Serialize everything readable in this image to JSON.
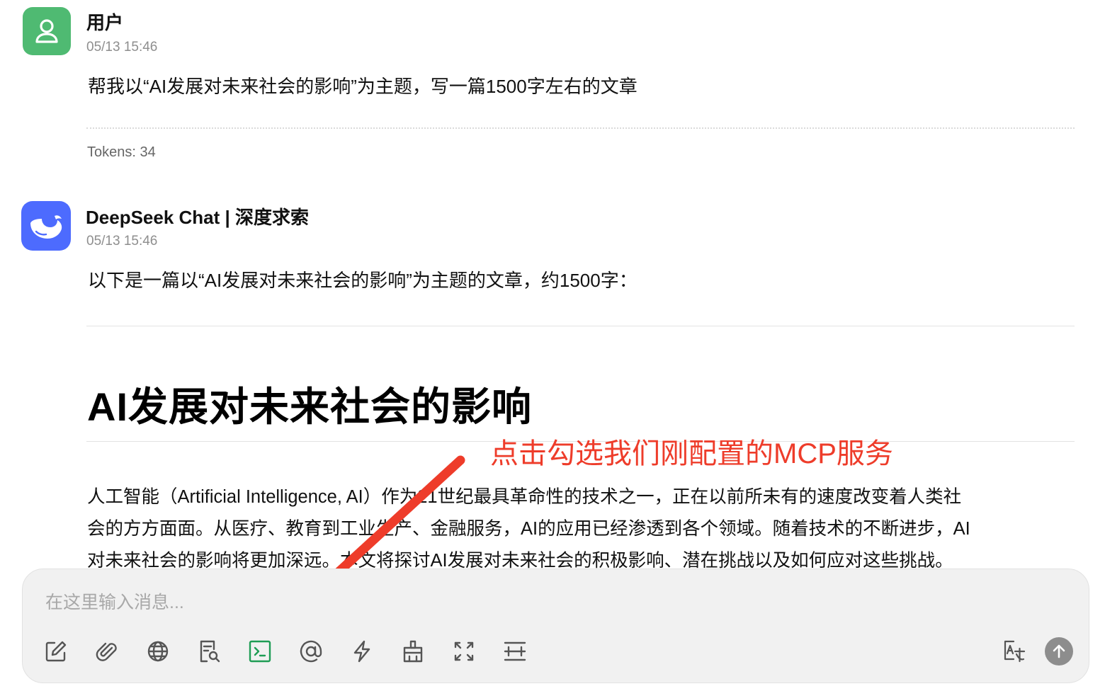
{
  "user_message": {
    "author": "用户",
    "time": "05/13 15:46",
    "text": "帮我以“AI发展对未来社会的影响”为主题，写一篇1500字左右的文章",
    "tokens": "Tokens: 34",
    "avatar_icon": "user-icon"
  },
  "assistant_message": {
    "author": "DeepSeek Chat | 深度求索",
    "time": "05/13 15:46",
    "intro": "以下是一篇以“AI发展对未来社会的影响”为主题的文章，约1500字：",
    "heading": "AI发展对未来社会的影响",
    "paragraph_lines": [
      "人工智能（Artificial Intelligence, AI）作为21世纪最具革命性的技术之一，正在以前所未有的速度改变着人类社",
      "会的方方面面。从医疗、教育到工业生产、金融服务，AI的应用已经渗透到各个领域。随着技术的不断进步，AI",
      "对未来社会的影响将更加深远。本文将探讨AI发展对未来社会的积极影响、潜在挑战以及如何应对这些挑战。"
    ],
    "avatar_icon": "whale-logo-icon"
  },
  "annotation": {
    "text": "点击勾选我们刚配置的MCP服务",
    "color": "#ee3c2a"
  },
  "composer": {
    "placeholder": "在这里输入消息...",
    "tools": [
      {
        "icon": "edit-icon"
      },
      {
        "icon": "attachment-icon"
      },
      {
        "icon": "globe-icon"
      },
      {
        "icon": "document-search-icon"
      },
      {
        "icon": "terminal-icon",
        "active": true,
        "color": "#1f9d55"
      },
      {
        "icon": "at-mention-icon"
      },
      {
        "icon": "lightning-icon"
      },
      {
        "icon": "broom-icon"
      },
      {
        "icon": "fullscreen-icon"
      },
      {
        "icon": "divider-icon"
      },
      {
        "icon": "translate-icon"
      }
    ],
    "send_icon": "arrow-up-icon"
  },
  "colors": {
    "user_avatar": "#4fba72",
    "bot_avatar": "#4d6bfe",
    "active_tool": "#1f9d55"
  }
}
